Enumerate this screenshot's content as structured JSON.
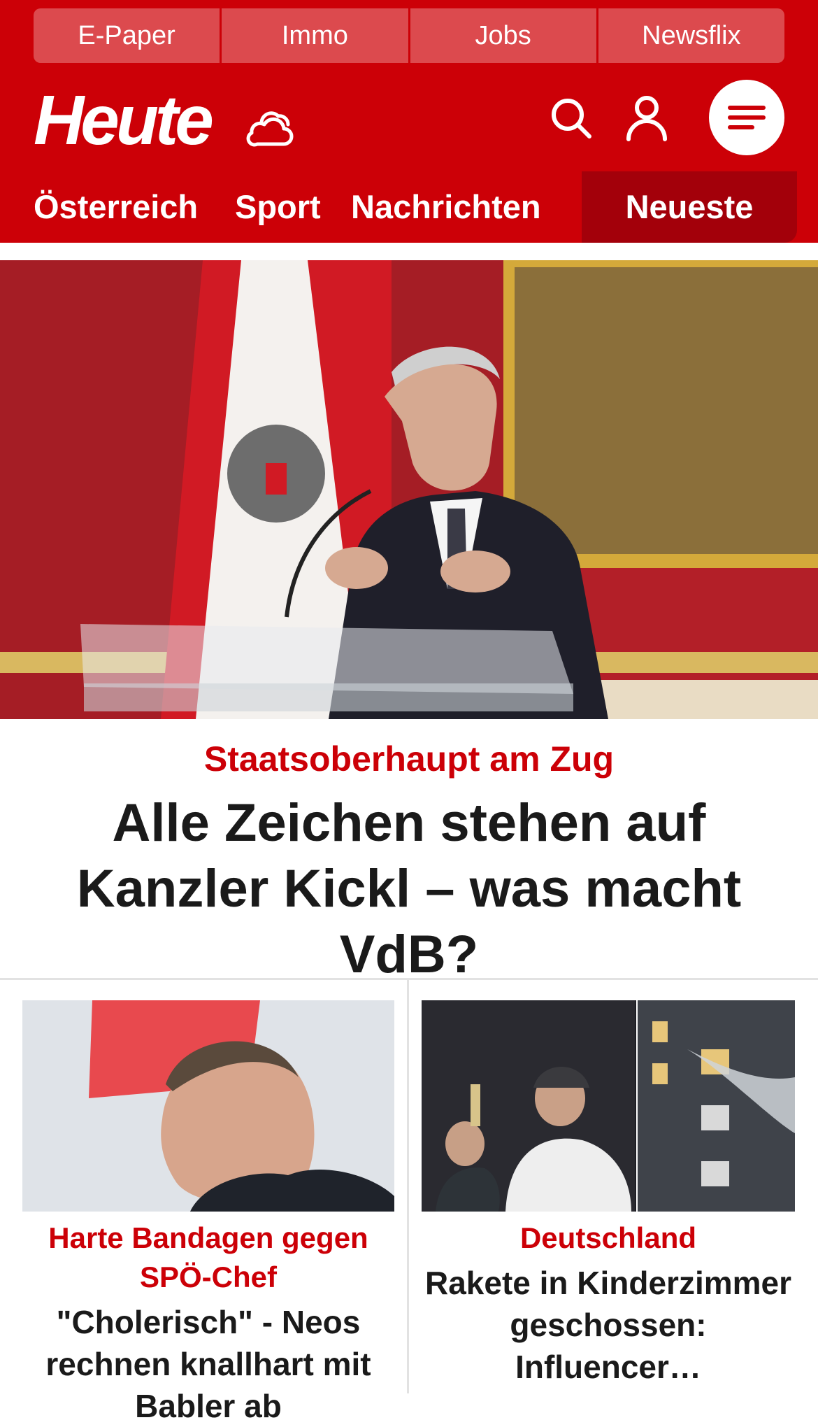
{
  "brand": {
    "logo_text": "Heute",
    "accent": "#cc0007",
    "accent_dark": "#a3000a"
  },
  "quicklinks": [
    {
      "label": "E-Paper"
    },
    {
      "label": "Immo"
    },
    {
      "label": "Jobs"
    },
    {
      "label": "Newsflix"
    }
  ],
  "header_icons": [
    "weather-icon",
    "search-icon",
    "user-icon",
    "menu-icon"
  ],
  "nav": {
    "items": [
      {
        "label": "Österreich"
      },
      {
        "label": "Sport"
      },
      {
        "label": "Nachrichten"
      }
    ],
    "highlight": {
      "label": "Neueste"
    }
  },
  "hero": {
    "kicker": "Staatsoberhaupt am Zug",
    "title": "Alle Zeichen stehen auf Kanzler Kickl – was macht VdB?"
  },
  "cards": [
    {
      "kicker": "Harte Bandagen gegen SPÖ-Chef",
      "title": "\"Cholerisch\" - Neos rechnen knallhart mit Babler ab"
    },
    {
      "kicker": "Deutschland",
      "title": "Rakete in Kinderzimmer geschossen: Influencer…"
    }
  ]
}
